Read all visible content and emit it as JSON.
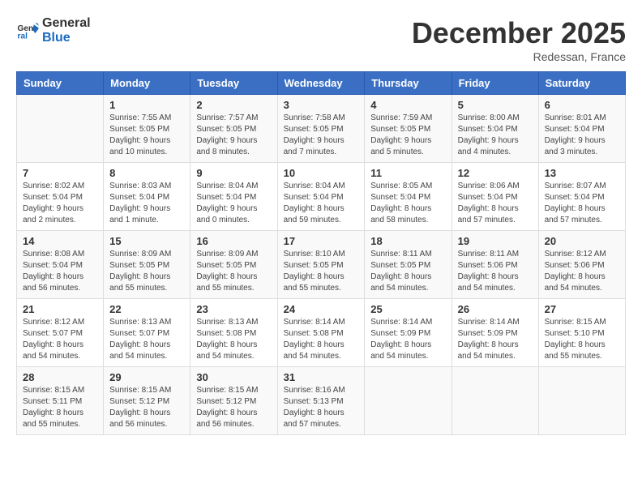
{
  "logo": {
    "line1": "General",
    "line2": "Blue"
  },
  "title": "December 2025",
  "subtitle": "Redessan, France",
  "headers": [
    "Sunday",
    "Monday",
    "Tuesday",
    "Wednesday",
    "Thursday",
    "Friday",
    "Saturday"
  ],
  "weeks": [
    [
      {
        "day": "",
        "info": ""
      },
      {
        "day": "1",
        "info": "Sunrise: 7:55 AM\nSunset: 5:05 PM\nDaylight: 9 hours\nand 10 minutes."
      },
      {
        "day": "2",
        "info": "Sunrise: 7:57 AM\nSunset: 5:05 PM\nDaylight: 9 hours\nand 8 minutes."
      },
      {
        "day": "3",
        "info": "Sunrise: 7:58 AM\nSunset: 5:05 PM\nDaylight: 9 hours\nand 7 minutes."
      },
      {
        "day": "4",
        "info": "Sunrise: 7:59 AM\nSunset: 5:05 PM\nDaylight: 9 hours\nand 5 minutes."
      },
      {
        "day": "5",
        "info": "Sunrise: 8:00 AM\nSunset: 5:04 PM\nDaylight: 9 hours\nand 4 minutes."
      },
      {
        "day": "6",
        "info": "Sunrise: 8:01 AM\nSunset: 5:04 PM\nDaylight: 9 hours\nand 3 minutes."
      }
    ],
    [
      {
        "day": "7",
        "info": "Sunrise: 8:02 AM\nSunset: 5:04 PM\nDaylight: 9 hours\nand 2 minutes."
      },
      {
        "day": "8",
        "info": "Sunrise: 8:03 AM\nSunset: 5:04 PM\nDaylight: 9 hours\nand 1 minute."
      },
      {
        "day": "9",
        "info": "Sunrise: 8:04 AM\nSunset: 5:04 PM\nDaylight: 9 hours\nand 0 minutes."
      },
      {
        "day": "10",
        "info": "Sunrise: 8:04 AM\nSunset: 5:04 PM\nDaylight: 8 hours\nand 59 minutes."
      },
      {
        "day": "11",
        "info": "Sunrise: 8:05 AM\nSunset: 5:04 PM\nDaylight: 8 hours\nand 58 minutes."
      },
      {
        "day": "12",
        "info": "Sunrise: 8:06 AM\nSunset: 5:04 PM\nDaylight: 8 hours\nand 57 minutes."
      },
      {
        "day": "13",
        "info": "Sunrise: 8:07 AM\nSunset: 5:04 PM\nDaylight: 8 hours\nand 57 minutes."
      }
    ],
    [
      {
        "day": "14",
        "info": "Sunrise: 8:08 AM\nSunset: 5:04 PM\nDaylight: 8 hours\nand 56 minutes."
      },
      {
        "day": "15",
        "info": "Sunrise: 8:09 AM\nSunset: 5:05 PM\nDaylight: 8 hours\nand 55 minutes."
      },
      {
        "day": "16",
        "info": "Sunrise: 8:09 AM\nSunset: 5:05 PM\nDaylight: 8 hours\nand 55 minutes."
      },
      {
        "day": "17",
        "info": "Sunrise: 8:10 AM\nSunset: 5:05 PM\nDaylight: 8 hours\nand 55 minutes."
      },
      {
        "day": "18",
        "info": "Sunrise: 8:11 AM\nSunset: 5:05 PM\nDaylight: 8 hours\nand 54 minutes."
      },
      {
        "day": "19",
        "info": "Sunrise: 8:11 AM\nSunset: 5:06 PM\nDaylight: 8 hours\nand 54 minutes."
      },
      {
        "day": "20",
        "info": "Sunrise: 8:12 AM\nSunset: 5:06 PM\nDaylight: 8 hours\nand 54 minutes."
      }
    ],
    [
      {
        "day": "21",
        "info": "Sunrise: 8:12 AM\nSunset: 5:07 PM\nDaylight: 8 hours\nand 54 minutes."
      },
      {
        "day": "22",
        "info": "Sunrise: 8:13 AM\nSunset: 5:07 PM\nDaylight: 8 hours\nand 54 minutes."
      },
      {
        "day": "23",
        "info": "Sunrise: 8:13 AM\nSunset: 5:08 PM\nDaylight: 8 hours\nand 54 minutes."
      },
      {
        "day": "24",
        "info": "Sunrise: 8:14 AM\nSunset: 5:08 PM\nDaylight: 8 hours\nand 54 minutes."
      },
      {
        "day": "25",
        "info": "Sunrise: 8:14 AM\nSunset: 5:09 PM\nDaylight: 8 hours\nand 54 minutes."
      },
      {
        "day": "26",
        "info": "Sunrise: 8:14 AM\nSunset: 5:09 PM\nDaylight: 8 hours\nand 54 minutes."
      },
      {
        "day": "27",
        "info": "Sunrise: 8:15 AM\nSunset: 5:10 PM\nDaylight: 8 hours\nand 55 minutes."
      }
    ],
    [
      {
        "day": "28",
        "info": "Sunrise: 8:15 AM\nSunset: 5:11 PM\nDaylight: 8 hours\nand 55 minutes."
      },
      {
        "day": "29",
        "info": "Sunrise: 8:15 AM\nSunset: 5:12 PM\nDaylight: 8 hours\nand 56 minutes."
      },
      {
        "day": "30",
        "info": "Sunrise: 8:15 AM\nSunset: 5:12 PM\nDaylight: 8 hours\nand 56 minutes."
      },
      {
        "day": "31",
        "info": "Sunrise: 8:16 AM\nSunset: 5:13 PM\nDaylight: 8 hours\nand 57 minutes."
      },
      {
        "day": "",
        "info": ""
      },
      {
        "day": "",
        "info": ""
      },
      {
        "day": "",
        "info": ""
      }
    ]
  ]
}
